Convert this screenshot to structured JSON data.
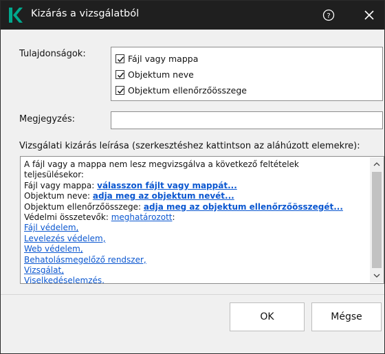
{
  "window": {
    "title": "Kizárás a vizsgálatból",
    "help_icon": "help-circle-icon",
    "close_icon": "close-icon",
    "logo_icon": "kaspersky-logo-icon",
    "accent": "#00a88e"
  },
  "properties": {
    "label": "Tulajdonságok:",
    "items": [
      {
        "label": "Fájl vagy mappa",
        "checked": true
      },
      {
        "label": "Objektum neve",
        "checked": true
      },
      {
        "label": "Objektum ellenőrzőösszege",
        "checked": true
      }
    ]
  },
  "note": {
    "label": "Megjegyzés:",
    "value": ""
  },
  "description": {
    "label": "Vizsgálati kizárás leírása (szerkesztéshez kattintson az aláhúzott elemekre):",
    "intro_line1": "A fájl vagy a mappa nem lesz megvizsgálva a következő feltételek",
    "intro_line2": "teljesülésekor:",
    "file_prefix": "Fájl vagy mappa: ",
    "file_link": "válasszon fájlt vagy mappát...",
    "name_prefix": "Objektum neve: ",
    "name_link": "adja meg az objektum nevét...",
    "hash_prefix": "Objektum ellenőrzőösszege: ",
    "hash_link": "adja meg az objektum ellenőrzőösszegét...",
    "components_prefix": "Védelmi összetevők: ",
    "components_link": "meghatározott",
    "components_suffix": ":",
    "components": [
      "Fájl védelem,",
      "Levelezés védelem,",
      "Web védelem,",
      "Behatolásmegelőző rendszer,",
      "Vizsgálat,",
      "Viselkedéselemzés,"
    ]
  },
  "buttons": {
    "ok": "OK",
    "cancel": "Mégse"
  }
}
